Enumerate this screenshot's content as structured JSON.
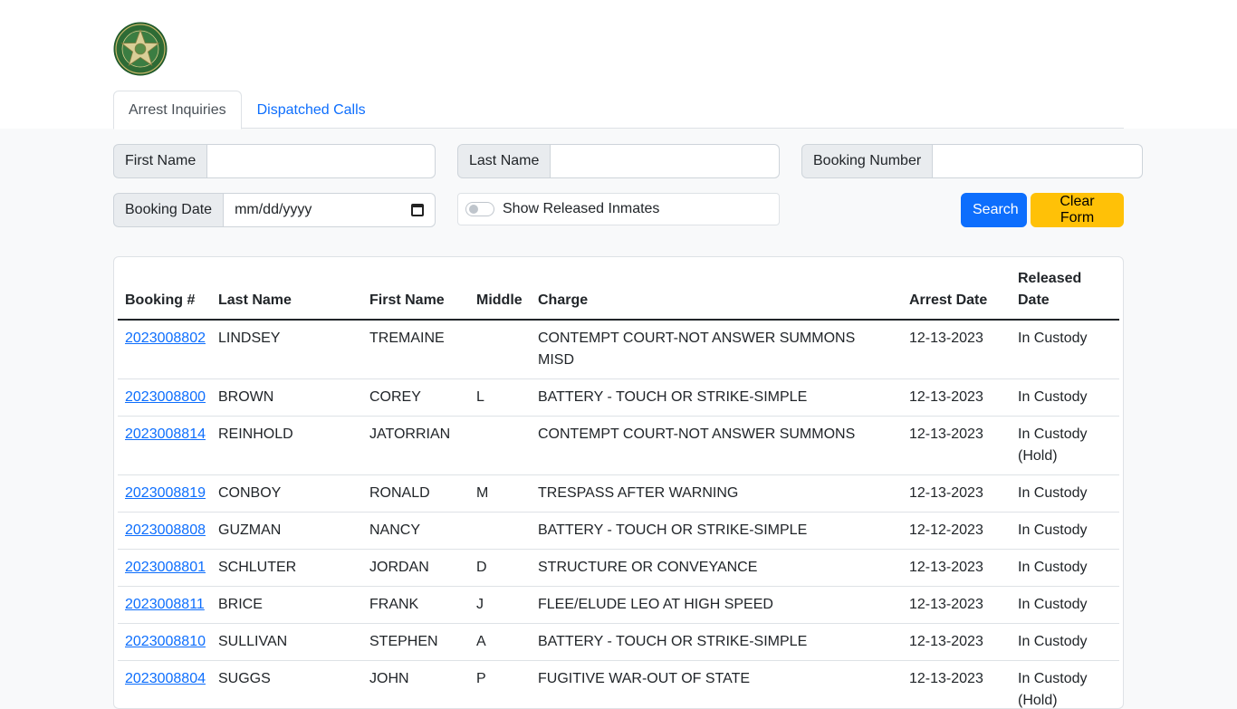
{
  "logo": {
    "icon": "sheriff-star-badge"
  },
  "tabs": [
    {
      "label": "Arrest Inquiries",
      "active": true
    },
    {
      "label": "Dispatched Calls",
      "active": false
    }
  ],
  "form": {
    "first_name_label": "First Name",
    "first_name_value": "",
    "last_name_label": "Last Name",
    "last_name_value": "",
    "booking_number_label": "Booking Number",
    "booking_number_value": "",
    "booking_date_label": "Booking Date",
    "booking_date_placeholder": "mm/dd/yyyy",
    "show_released_label": "Show Released Inmates",
    "show_released_checked": false,
    "search_label": "Search",
    "clear_label": "Clear Form"
  },
  "colors": {
    "primary": "#0d6efd",
    "warning": "#ffc107",
    "logo_green": "#2e6b35",
    "logo_gold": "#c9b86a"
  },
  "table": {
    "headers": [
      "Booking #",
      "Last Name",
      "First Name",
      "Middle",
      "Charge",
      "Arrest Date",
      "Released Date"
    ],
    "rows": [
      [
        "2023008802",
        "LINDSEY",
        "TREMAINE",
        "",
        "CONTEMPT COURT-NOT ANSWER SUMMONS MISD",
        "12-13-2023",
        "In Custody"
      ],
      [
        "2023008800",
        "BROWN",
        "COREY",
        "L",
        "BATTERY - TOUCH OR STRIKE-SIMPLE",
        "12-13-2023",
        "In Custody"
      ],
      [
        "2023008814",
        "REINHOLD",
        "JATORRIAN",
        "",
        "CONTEMPT COURT-NOT ANSWER SUMMONS",
        "12-13-2023",
        "In Custody (Hold)"
      ],
      [
        "2023008819",
        "CONBOY",
        "RONALD",
        "M",
        "TRESPASS AFTER WARNING",
        "12-13-2023",
        "In Custody"
      ],
      [
        "2023008808",
        "GUZMAN",
        "NANCY",
        "",
        "BATTERY - TOUCH OR STRIKE-SIMPLE",
        "12-12-2023",
        "In Custody"
      ],
      [
        "2023008801",
        "SCHLUTER",
        "JORDAN",
        "D",
        "STRUCTURE OR CONVEYANCE",
        "12-13-2023",
        "In Custody"
      ],
      [
        "2023008811",
        "BRICE",
        "FRANK",
        "J",
        "FLEE/ELUDE LEO AT HIGH SPEED",
        "12-13-2023",
        "In Custody"
      ],
      [
        "2023008810",
        "SULLIVAN",
        "STEPHEN",
        "A",
        "BATTERY - TOUCH OR STRIKE-SIMPLE",
        "12-13-2023",
        "In Custody"
      ],
      [
        "2023008804",
        "SUGGS",
        "JOHN",
        "P",
        "FUGITIVE WAR-OUT OF STATE",
        "12-13-2023",
        "In Custody (Hold)"
      ]
    ]
  }
}
